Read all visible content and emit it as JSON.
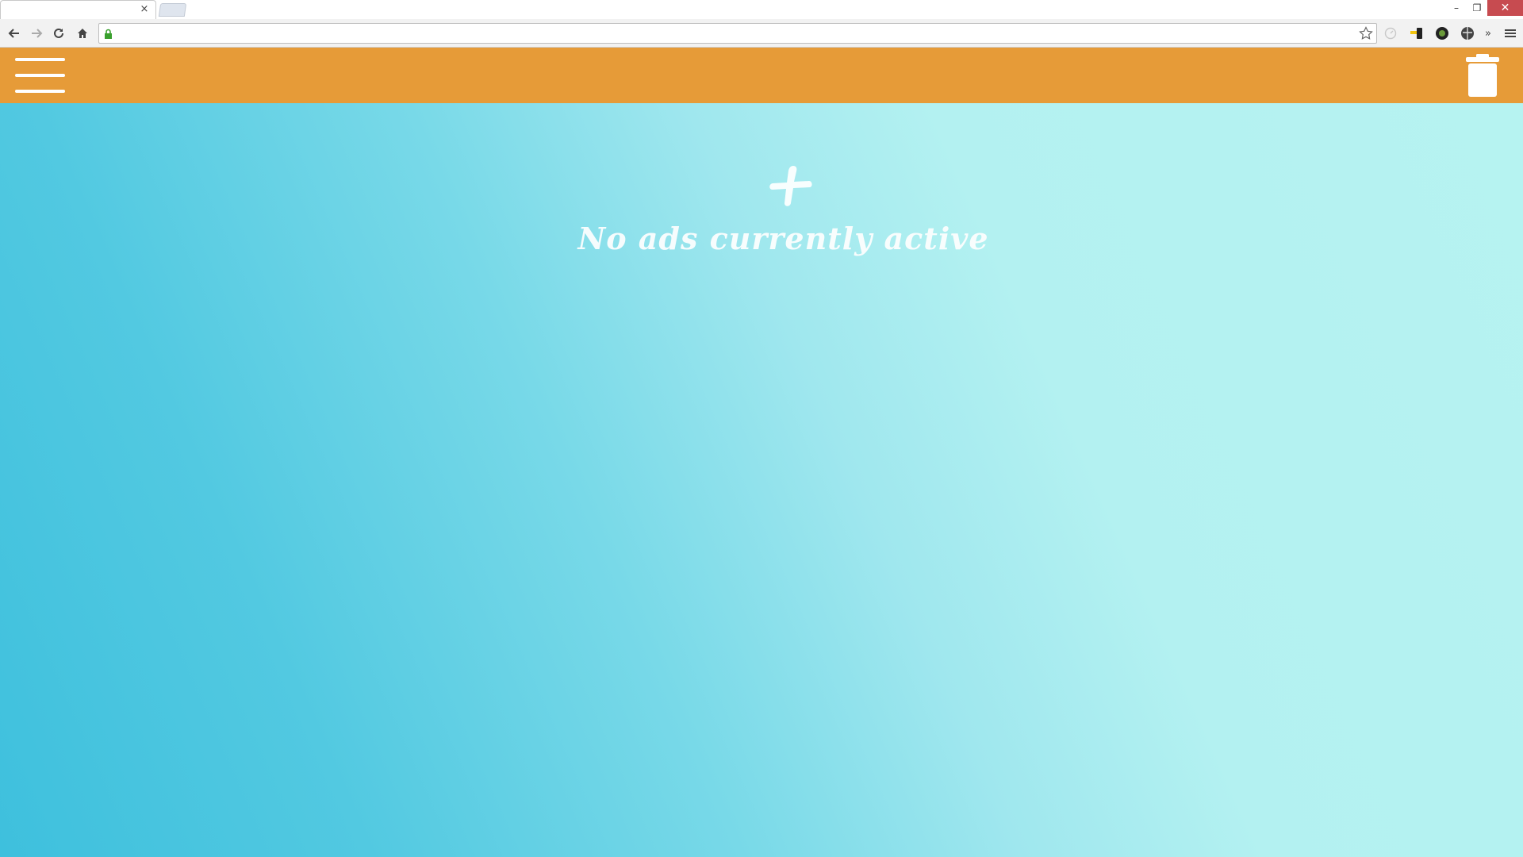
{
  "browser": {
    "tab": {
      "title": "",
      "close_glyph": "×"
    },
    "window_controls": {
      "minimize": "–",
      "restore": "❐",
      "close": "✕"
    },
    "address_bar": {
      "value": "",
      "placeholder": ""
    },
    "icons": [
      "back-icon",
      "forward-icon",
      "reload-icon",
      "home-icon",
      "lock-icon",
      "star-icon",
      "extension-icon",
      "chrome-menu-icon"
    ],
    "overflow_label": "»"
  },
  "app": {
    "colors": {
      "header": "#e69b38",
      "gradient_start": "#3ec0dd",
      "gradient_end": "#b6f3f1",
      "foreground": "#ffffff"
    },
    "header": {
      "menu_icon": "hamburger-icon",
      "delete_icon": "trash-icon"
    },
    "main": {
      "add_icon": "plus-icon",
      "empty_message": "No ads currently active"
    }
  }
}
